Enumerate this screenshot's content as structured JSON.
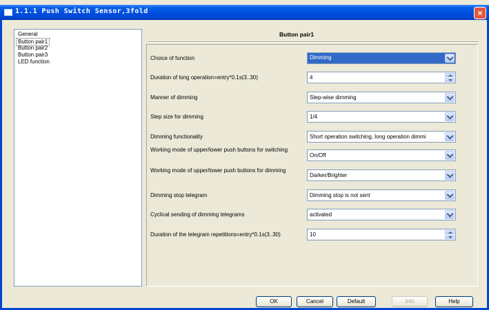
{
  "window": {
    "title": "1.1.1 Push Switch Sensor,3fold",
    "close_glyph": "×"
  },
  "tree": {
    "items": [
      {
        "label": "General"
      },
      {
        "label": "Button pair1"
      },
      {
        "label": "Button pair2"
      },
      {
        "label": "Button pair3"
      },
      {
        "label": "LED function"
      }
    ]
  },
  "panel": {
    "title": "Button pair1",
    "params": [
      {
        "label": "Choice of function",
        "value": "Dimming",
        "type": "dropdown"
      },
      {
        "label": "Duration of long operation=entry*0.1s(3..30)",
        "value": "4",
        "type": "spinner"
      },
      {
        "label": "Manner of dimming",
        "value": "Step-wise dimming",
        "type": "dropdown"
      },
      {
        "label": "Step size for dimming",
        "value": "1/4",
        "type": "dropdown"
      },
      {
        "label": "Dimming functionality",
        "value": "Short operation switching, long operation  dimmi",
        "type": "dropdown"
      },
      {
        "label": "Working mode of upper/lower push buttons for switching",
        "value": "On/Off",
        "type": "dropdown"
      },
      {
        "label": "Working mode of upper/lower push buttons for dimming",
        "value": "Darker/Brighter",
        "type": "dropdown"
      },
      {
        "label": "Dimming stop telegram",
        "value": "Dimming stop is not sent",
        "type": "dropdown"
      },
      {
        "label": "Cyclical sending of dimming telegrams",
        "value": "activated",
        "type": "dropdown"
      },
      {
        "label": "Duration of the telegram repetitions=entry*0.1s(3..30)",
        "value": "10",
        "type": "spinner"
      }
    ]
  },
  "buttons": {
    "ok": "OK",
    "cancel": "Cancel",
    "default": "Default",
    "info": "Info",
    "help": "Help"
  },
  "colors": {
    "titlebar": "#0050e0",
    "selection": "#3169c6",
    "dialog_bg": "#ece9d8"
  }
}
